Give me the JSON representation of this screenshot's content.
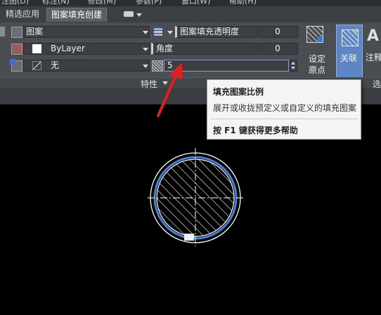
{
  "menubar": {
    "items": [
      "注图(D)",
      "标注(N)",
      "修改(M)",
      "参数(P)",
      "窗口(W)",
      "帮助(H)"
    ]
  },
  "tabs": [
    {
      "label": "精选应用",
      "active": false
    },
    {
      "label": "图案填充创建",
      "active": true
    }
  ],
  "properties": {
    "hatch_type": "图案",
    "hatch_color": "ByLayer",
    "background_color": "无",
    "transparency_label": "图案填充透明度",
    "transparency_value": "0",
    "angle_label": "角度",
    "angle_value": "0",
    "scale_value": "5",
    "panel_title": "特性"
  },
  "buttons": {
    "set_origin_line1": "设定",
    "set_origin_line2": "原点",
    "associative": "关联",
    "annotative": "注释",
    "options_partial": "选"
  },
  "tooltip": {
    "title": "填充图案比例",
    "description": "展开或收拢预定义或自定义的填充图案",
    "help": "按 F1 键获得更多帮助"
  },
  "colors": {
    "ribbon_bg": "#4a4e53",
    "canvas_bg": "#000000",
    "selection_highlight": "#4a7fd6",
    "annotation_arrow": "#e02020"
  }
}
